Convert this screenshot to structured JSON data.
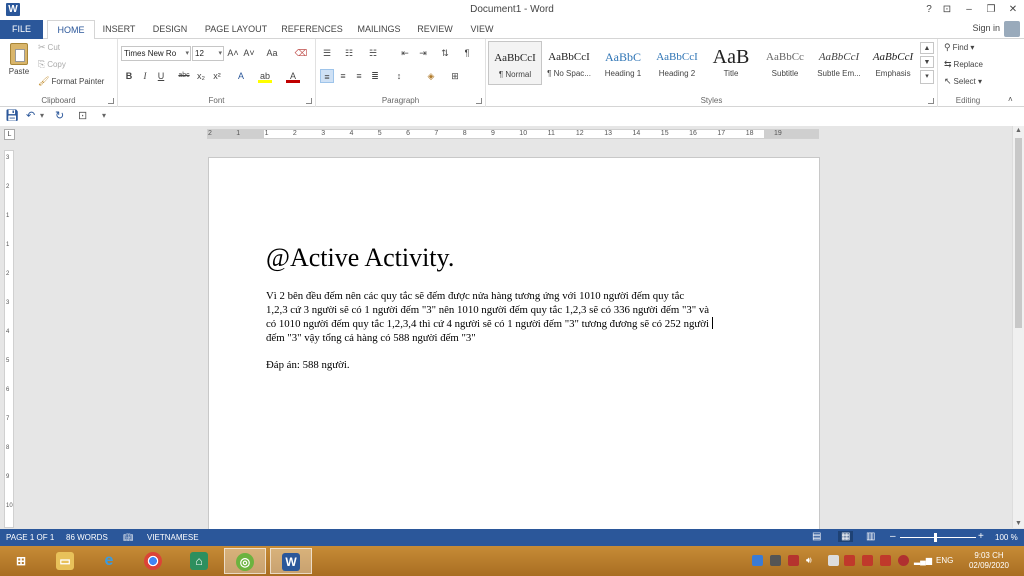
{
  "window": {
    "title": "Document1 - Word",
    "help": "?",
    "ribbon_options": "⊡",
    "minimize": "–",
    "restore": "❐",
    "close": "✕"
  },
  "tabs": {
    "file": "FILE",
    "items": [
      "HOME",
      "INSERT",
      "DESIGN",
      "PAGE LAYOUT",
      "REFERENCES",
      "MAILINGS",
      "REVIEW",
      "VIEW"
    ],
    "active": "HOME",
    "sign_in": "Sign in"
  },
  "clipboard": {
    "paste": "Paste",
    "cut": "Cut",
    "copy": "Copy",
    "format_painter": "Format Painter",
    "label": "Clipboard"
  },
  "font": {
    "name": "Times New Ro",
    "size": "12",
    "bold": "B",
    "italic": "I",
    "underline": "U",
    "strike": "abc",
    "subscript": "x₂",
    "superscript": "x²",
    "grow": "A˄",
    "shrink": "A˅",
    "case": "Aa",
    "label": "Font"
  },
  "paragraph": {
    "label": "Paragraph",
    "pilcrow": "¶"
  },
  "styles": {
    "items": [
      {
        "sample": "AaBbCcI",
        "name": "¶ Normal"
      },
      {
        "sample": "AaBbCcI",
        "name": "¶ No Spac..."
      },
      {
        "sample": "AaBbC",
        "name": "Heading 1"
      },
      {
        "sample": "AaBbCcI",
        "name": "Heading 2"
      },
      {
        "sample": "AaB",
        "name": "Title"
      },
      {
        "sample": "AaBbCc",
        "name": "Subtitle"
      },
      {
        "sample": "AaBbCcI",
        "name": "Subtle Em..."
      },
      {
        "sample": "AaBbCcI",
        "name": "Emphasis"
      }
    ],
    "label": "Styles"
  },
  "editing": {
    "find": "Find",
    "replace": "Replace",
    "select": "Select",
    "label": "Editing"
  },
  "ruler": {
    "h_numbers": [
      "2",
      "1",
      "1",
      "2",
      "3",
      "4",
      "5",
      "6",
      "7",
      "8",
      "9",
      "10",
      "11",
      "12",
      "13",
      "14",
      "15",
      "16",
      "17",
      "18",
      "19"
    ],
    "v_numbers": [
      "3",
      "2",
      "1",
      "1",
      "2",
      "3",
      "4",
      "5",
      "6",
      "7",
      "8",
      "9",
      "10"
    ]
  },
  "document": {
    "heading": "@Active Activity.",
    "lines": [
      "Vì 2 bên đều đếm nên các quy tắc sẽ đếm được nửa hàng tương ứng với 1010 người đếm quy tắc",
      "1,2,3 cứ 3 người sẽ có 1 người đếm \"3\" nên 1010 người đếm quy tắc 1,2,3 sẽ có 336 người đếm \"3\" và",
      "có 1010 người đếm quy tắc 1,2,3,4 thì cứ 4 người sẽ có 1 người đếm \"3\" tương đương sẽ có 252 người",
      "đếm \"3\" vậy tổng cả hàng có 588 người đếm \"3\""
    ],
    "answer": "Đáp án: 588 người."
  },
  "status": {
    "page": "PAGE 1 OF 1",
    "words": "86 WORDS",
    "language": "VIETNAMESE",
    "zoom": "100 %",
    "zoom_level": 1.0
  },
  "taskbar": {
    "lang": "ENG",
    "time": "9:03 CH",
    "date": "02/09/2020"
  },
  "colors": {
    "word_blue": "#2b579a",
    "taskbar": "#b97c2c"
  }
}
